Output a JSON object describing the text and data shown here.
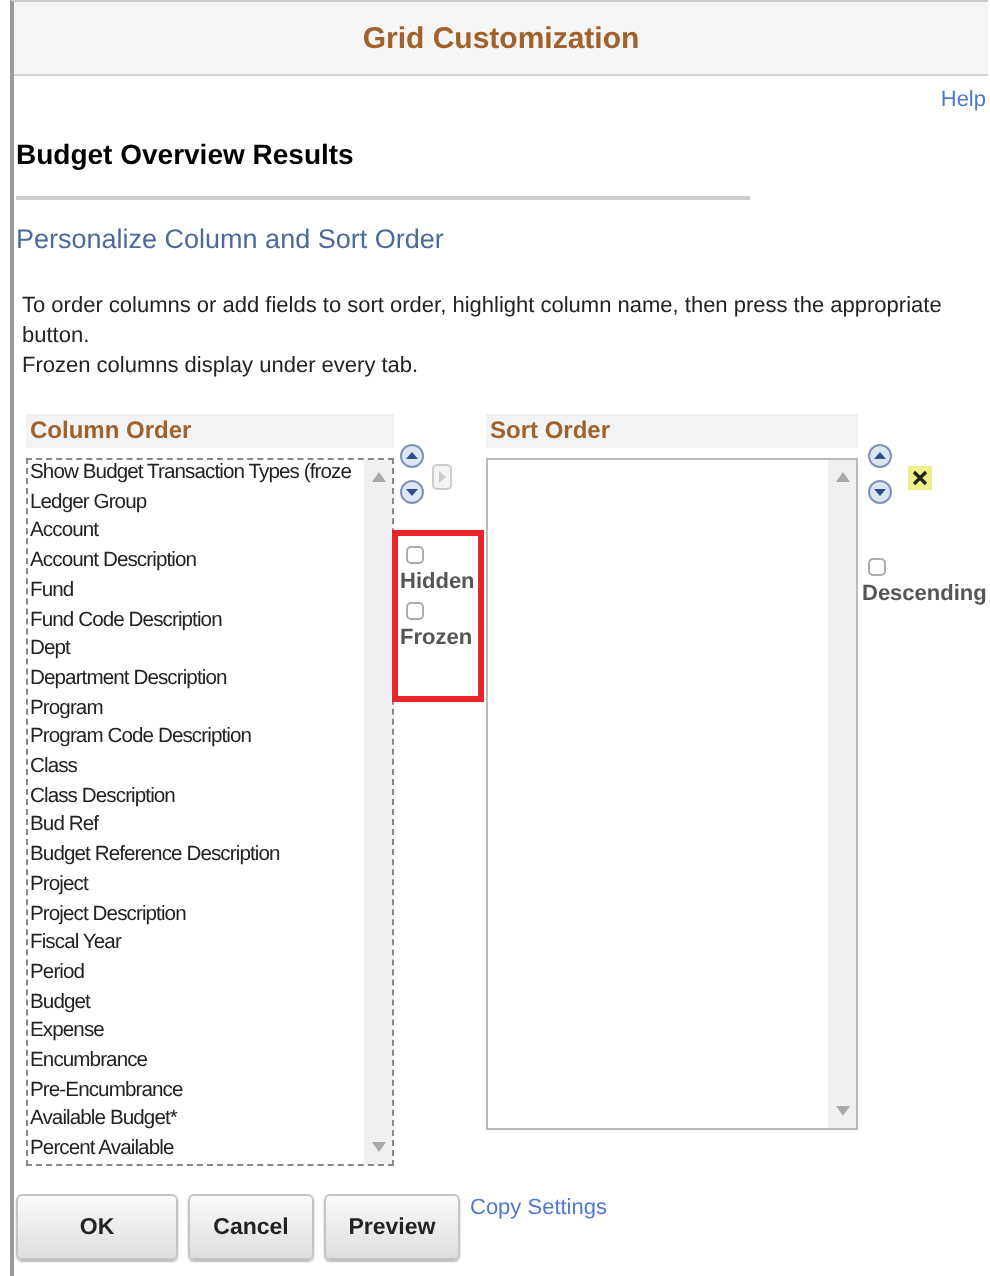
{
  "window": {
    "title": "Grid Customization"
  },
  "help_link": "Help",
  "page_title": "Budget Overview Results",
  "section_title": "Personalize Column and Sort Order",
  "instructions": [
    "To order columns or add fields to sort order, highlight column name, then press the appropriate button.",
    "Frozen columns display under every tab."
  ],
  "column_order": {
    "heading": "Column Order",
    "items": [
      "Show Budget Transaction Types (froze",
      "Ledger Group",
      "Account",
      "Account Description",
      "Fund",
      "Fund Code Description",
      "Dept",
      "Department Description",
      "Program",
      "Program Code Description",
      "Class",
      "Class Description",
      "Bud Ref",
      "Budget Reference Description",
      "Project",
      "Project Description",
      "Fiscal Year",
      "Period",
      "Budget",
      "Expense",
      "Encumbrance",
      "Pre-Encumbrance",
      "Available Budget*",
      "Percent Available"
    ]
  },
  "column_options": [
    {
      "label": "Hidden",
      "checked": false
    },
    {
      "label": "Frozen",
      "checked": false
    }
  ],
  "sort_order": {
    "heading": "Sort Order"
  },
  "descending": {
    "label": "Descending",
    "checked": false
  },
  "buttons": [
    "OK",
    "Cancel",
    "Preview"
  ],
  "copy_settings_link": "Copy Settings"
}
